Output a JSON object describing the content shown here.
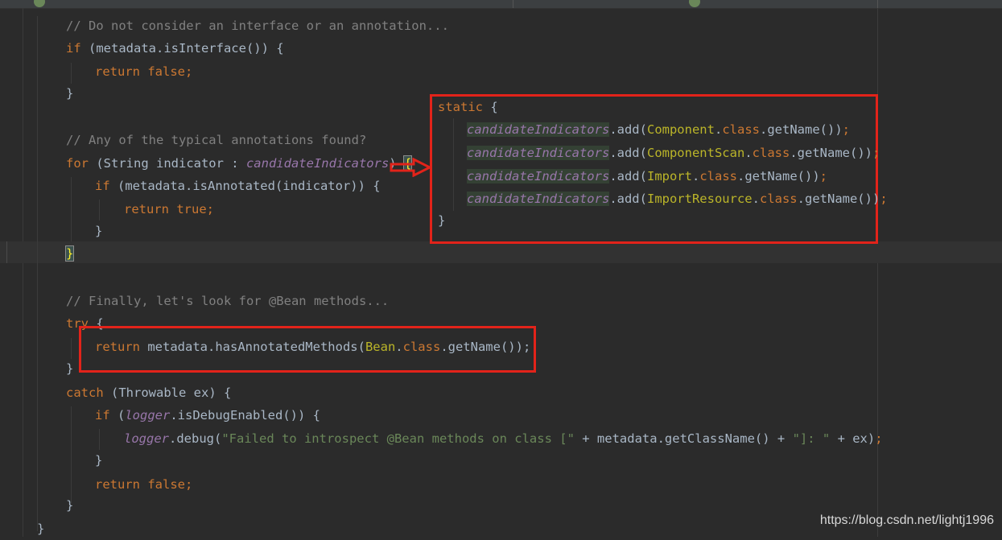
{
  "editor": {
    "theme_colors": {
      "background": "#2b2b2b",
      "keyword": "#cc7832",
      "comment": "#808080",
      "field": "#9876aa",
      "string": "#6a8759",
      "highlight_box": "#e2231a"
    },
    "lines": {
      "l1": "// Do not consider an interface or an annotation...",
      "l2_kw": "if",
      "l2_rest": " (metadata.isInterface()) {",
      "l3_kw": "return false",
      "l3_end": ";",
      "l4": "}",
      "l6": "// Any of the typical annotations found?",
      "l7_kw": "for",
      "l7_mid": " (String indicator : ",
      "l7_field": "candidateIndicators",
      "l7_end": ")",
      "l7_brace": "{",
      "l8_kw": "if",
      "l8_rest": " (metadata.isAnnotated(indicator)) {",
      "l9_kw": "return true",
      "l9_end": ";",
      "l10": "}",
      "l11": "}",
      "l13": "// Finally, let's look for @Bean methods...",
      "l14_kw": "try",
      "l14_rest": " {",
      "l15_kw": "return",
      "l15_mid": " metadata.hasAnnotatedMethods(",
      "l15_type": "Bean",
      "l15_dot": ".",
      "l15_cls": "class",
      "l15_end": ".getName());",
      "l16": "}",
      "l17_kw": "catch",
      "l17_rest": " (Throwable ex) {",
      "l18_kw": "if",
      "l18_open": " (",
      "l18_field": "logger",
      "l18_rest": ".isDebugEnabled()) {",
      "l19_field": "logger",
      "l19_mid": ".debug(",
      "l19_str1": "\"Failed to introspect @Bean methods on class [\"",
      "l19_plus1": " + metadata.getClassName() + ",
      "l19_str2": "\"]: \"",
      "l19_end": " + ex)",
      "l19_semi": ";",
      "l20": "}",
      "l21_kw": "return false",
      "l21_end": ";",
      "l22": "}",
      "l23": "}"
    }
  },
  "callout": {
    "static_kw": "static",
    "open_brace": " {",
    "field": "candidateIndicators",
    "add": ".add(",
    "types": [
      "Component",
      "ComponentScan",
      "Import",
      "ImportResource"
    ],
    "dot": ".",
    "cls": "class",
    "get": ".getName())",
    "semi": ";",
    "close_brace": "}"
  },
  "watermark": "https://blog.csdn.net/lightj1996"
}
